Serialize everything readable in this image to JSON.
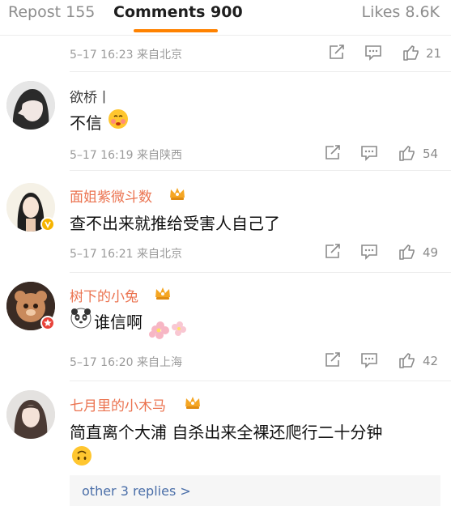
{
  "tabs": {
    "repost": "Repost 155",
    "comments": "Comments 900",
    "likes": "Likes 8.6K"
  },
  "colors": {
    "accent": "#ff8200",
    "vip_name": "#eb7350",
    "link": "#4a6ea8"
  },
  "top_partial": {
    "timestamp": "5–17 16:23 来自北京",
    "likes": "21"
  },
  "comments": [
    {
      "username": "欲桥丨",
      "text": "不信",
      "timestamp": "5–17 16:19 来自陕西",
      "likes": "54",
      "emoji": "blushing-face-emoji"
    },
    {
      "username": "面姐紫微斗数",
      "text": "查不出来就推给受害人自己了",
      "timestamp": "5–17 16:21 来自北京",
      "likes": "49"
    },
    {
      "username": "树下的小兔",
      "text": "谁信啊",
      "timestamp": "5–17 16:20 来自上海",
      "likes": "42",
      "emoji": "panda-emoji"
    },
    {
      "username": "七月里的小木马",
      "text": "简直离个大浦 自杀出来全裸还爬行二十分钟",
      "emoji": "upside-down-face-emoji"
    }
  ],
  "replies_link": "other 3 replies >"
}
